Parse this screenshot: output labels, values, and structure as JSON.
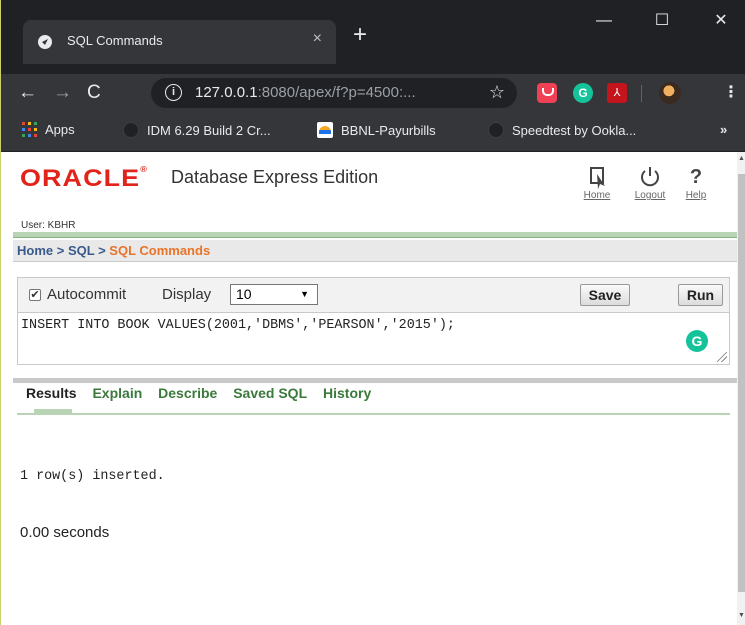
{
  "browser": {
    "tab_title": "SQL Commands",
    "tab_close": "×",
    "new_tab": "+",
    "window_controls": {
      "minimize": "—",
      "maximize": "☐",
      "close": "✕"
    },
    "nav": {
      "back": "←",
      "forward": "→",
      "reload": "C"
    },
    "url": {
      "host": "127.0.0.1",
      "rest": ":8080/apex/f?p=4500:..."
    },
    "bookmarks": [
      {
        "label": "Apps",
        "icon": "apps-grid-icon"
      },
      {
        "label": "IDM 6.29 Build 2 Cr...",
        "icon": "globe-icon"
      },
      {
        "label": "BBNL-Payurbills",
        "icon": "bbnl-icon"
      },
      {
        "label": "Speedtest by Ookla...",
        "icon": "globe-icon"
      }
    ],
    "bookmarks_more": "»",
    "extensions": {
      "grammarly": "G",
      "pdf": "⅄"
    },
    "menu": "⋮"
  },
  "header": {
    "logo": "ORACLE",
    "product": "Database Express Edition",
    "user": "User: KBHR",
    "links": {
      "home": "Home",
      "logout": "Logout",
      "help": "Help"
    }
  },
  "breadcrumb": {
    "home": "Home",
    "sep1": " > ",
    "sql": "SQL",
    "sep2": " > ",
    "current": "SQL Commands"
  },
  "commands": {
    "autocommit_label": "Autocommit",
    "autocommit_checked": true,
    "display_label": "Display",
    "display_value": "10",
    "save_label": "Save",
    "run_label": "Run",
    "sql_text": "INSERT INTO BOOK VALUES(2001,'DBMS','PEARSON','2015');"
  },
  "results": {
    "tabs": [
      "Results",
      "Explain",
      "Describe",
      "Saved SQL",
      "History"
    ],
    "message": "1 row(s) inserted.",
    "elapsed": "0.00 seconds"
  }
}
